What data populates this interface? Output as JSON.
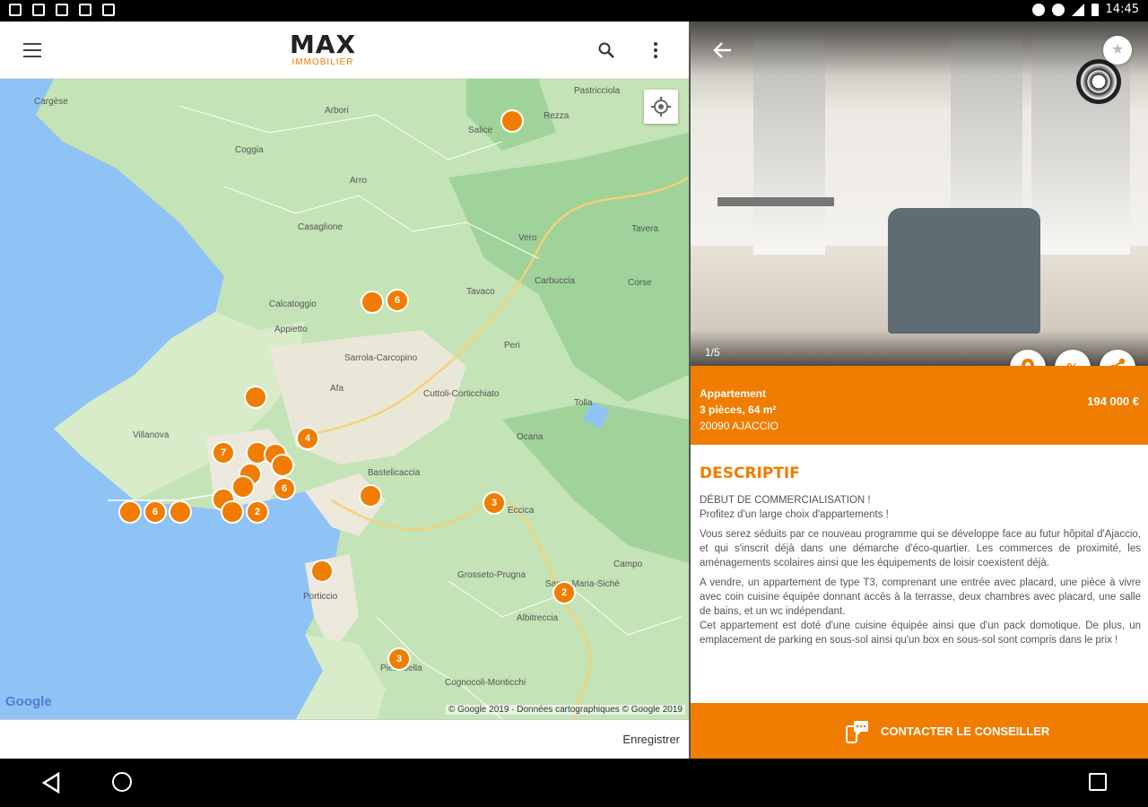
{
  "status_bar": {
    "time": "14:45"
  },
  "app_bar": {
    "logo_main": "MAX",
    "logo_sub": "IMMOBILIER",
    "menu_icon": "menu-icon",
    "search_icon": "search-icon",
    "more_icon": "more-vert-icon"
  },
  "map": {
    "places": [
      {
        "name": "Cargèse"
      },
      {
        "name": "Arbori"
      },
      {
        "name": "Pastricciola"
      },
      {
        "name": "Rezza"
      },
      {
        "name": "Salice"
      },
      {
        "name": "Coggia"
      },
      {
        "name": "Arro"
      },
      {
        "name": "Casaglione"
      },
      {
        "name": "Vero"
      },
      {
        "name": "Tavera"
      },
      {
        "name": "Carbuccia"
      },
      {
        "name": "Corse"
      },
      {
        "name": "Calcatoggio"
      },
      {
        "name": "Tavaco"
      },
      {
        "name": "Appietto"
      },
      {
        "name": "Peri"
      },
      {
        "name": "Sarrola-Carcopino"
      },
      {
        "name": "Afa"
      },
      {
        "name": "Cuttoli-Corticchiato"
      },
      {
        "name": "Tolla"
      },
      {
        "name": "Villanova"
      },
      {
        "name": "Ocana"
      },
      {
        "name": "Bastelicaccia"
      },
      {
        "name": "Eccica"
      },
      {
        "name": "Grosseto-Prugna"
      },
      {
        "name": "Campo"
      },
      {
        "name": "Santa-Maria-Siché"
      },
      {
        "name": "Albitreccia"
      },
      {
        "name": "Porticcio"
      },
      {
        "name": "Pietrosella"
      },
      {
        "name": "Cognocoli-Monticchi"
      }
    ],
    "markers": [
      {
        "label": ""
      },
      {
        "label": ""
      },
      {
        "label": "6"
      },
      {
        "label": ""
      },
      {
        "label": "4"
      },
      {
        "label": "7"
      },
      {
        "label": ""
      },
      {
        "label": ""
      },
      {
        "label": ""
      },
      {
        "label": "6"
      },
      {
        "label": ""
      },
      {
        "label": ""
      },
      {
        "label": ""
      },
      {
        "label": "2"
      },
      {
        "label": ""
      },
      {
        "label": "6"
      },
      {
        "label": ""
      },
      {
        "label": ""
      },
      {
        "label": ""
      },
      {
        "label": "3"
      },
      {
        "label": ""
      },
      {
        "label": "2"
      },
      {
        "label": "3"
      }
    ],
    "google_label": "Google",
    "credit": "© Google 2019 · Données cartographiques © Google 2019"
  },
  "bottom_bar": {
    "save_label": "Enregistrer"
  },
  "listing": {
    "photo_counter": "1/5",
    "type": "Appartement",
    "details": "3 pièces, 64 m²",
    "city": "20090 AJACCIO",
    "price": "194 000 €",
    "section_title": "DESCRIPTIF",
    "para1_line1": "DÉBUT DE COMMERCIALISATION !",
    "para1_line2": "Profitez d'un large choix d'appartements !",
    "para2": "Vous serez séduits par ce nouveau programme qui se développe face au futur hôpital d'Ajaccio, et qui s'inscrit déjà dans une démarche d'éco-quartier. Les commerces de proximité, les aménagements scolaires ainsi que les équipements de loisir coexistent déjà.",
    "para3": "A vendre, un appartement de type T3, comprenant une entrée avec placard, une pièce à vivre avec coin cuisine équipée donnant accès à la terrasse, deux chambres avec placard, une salle de bains, et un wc indépendant.",
    "para4": "Cet appartement est doté d'une cuisine équipée ainsi que d'un pack domotique. De plus, un emplacement de parking en sous-sol ainsi qu'un box en sous-sol sont compris dans le prix !",
    "contact_label": "CONTACTER LE CONSEILLER"
  },
  "colors": {
    "accent": "#f07c00",
    "sea": "#8fc3f5",
    "land": "#c4e3b6"
  }
}
